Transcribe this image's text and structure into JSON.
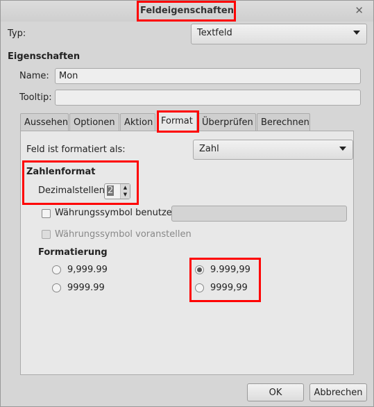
{
  "dialog": {
    "title": "Feldeigenschaften",
    "close_icon": "close-icon"
  },
  "type": {
    "label": "Typ:",
    "value": "Textfeld"
  },
  "properties": {
    "heading": "Eigenschaften",
    "name_label": "Name:",
    "name_value": "Mon",
    "tooltip_label": "Tooltip:",
    "tooltip_value": ""
  },
  "tabs": [
    {
      "label": "Aussehen"
    },
    {
      "label": "Optionen"
    },
    {
      "label": "Aktion"
    },
    {
      "label": "Format",
      "active": true
    },
    {
      "label": "Überprüfen"
    },
    {
      "label": "Berechnen"
    }
  ],
  "format": {
    "format_as_label": "Feld ist formatiert als:",
    "format_as_value": "Zahl",
    "number_format_heading": "Zahlenformat",
    "decimals_label": "Dezimalstellen:",
    "decimals_value": "2",
    "currency_use_label": "Währungssymbol benutzen",
    "currency_use_checked": false,
    "currency_symbol_value": "",
    "currency_prepend_label": "Währungssymbol voranstellen",
    "currency_prepend_checked": false,
    "currency_prepend_disabled": true,
    "formatting_heading": "Formatierung",
    "options": [
      {
        "label": "9,999.99",
        "selected": false
      },
      {
        "label": "9999.99",
        "selected": false
      },
      {
        "label": "9.999,99",
        "selected": true
      },
      {
        "label": "9999,99",
        "selected": false
      }
    ]
  },
  "buttons": {
    "ok": "OK",
    "cancel": "Abbrechen"
  },
  "highlight_color": "#ff0000"
}
